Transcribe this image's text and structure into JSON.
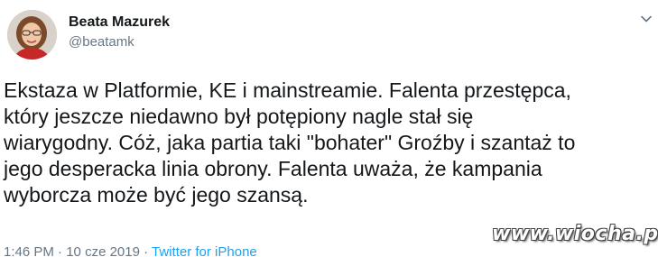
{
  "tweet": {
    "author_name": "Beata Mazurek",
    "author_handle": "@beatamk",
    "text_lines": [
      "Ekstaza w Platformie, KE i mainstreamie. Falenta przestępca,",
      "który jeszcze niedawno był potępiony nagle stał się",
      "wiarygodny. Cóż, jaka partia taki \"bohater\" Groźby i szantaż to",
      "jego desperacka linia obrony. Falenta uważa, że kampania",
      "wyborcza może być jego szansą."
    ],
    "time": "1:46 PM",
    "separator": "·",
    "date": "10 cze 2019",
    "source": "Twitter for iPhone"
  },
  "watermark": {
    "text": "www.wiocha.pl"
  },
  "colors": {
    "text_primary": "#14171a",
    "text_secondary": "#657786",
    "link": "#1da1f2",
    "background": "#ffffff"
  },
  "icons": {
    "caret": "chevron-down-icon",
    "avatar": "avatar"
  }
}
